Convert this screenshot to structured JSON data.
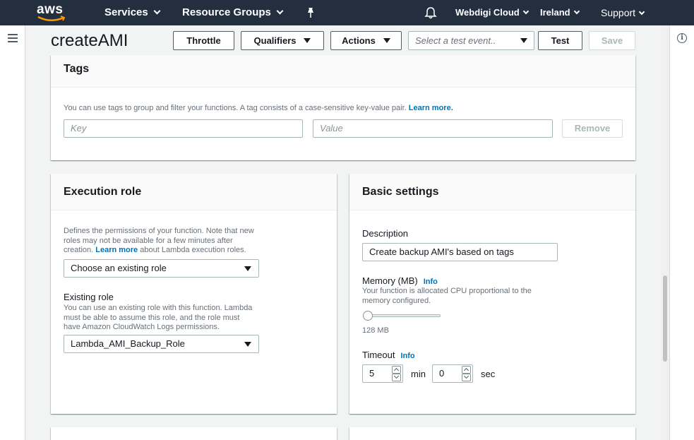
{
  "topnav": {
    "logo_text": "aws",
    "services": "Services",
    "resource_groups": "Resource Groups",
    "account": "Webdigi Cloud",
    "region": "Ireland",
    "support": "Support"
  },
  "header": {
    "function_name": "createAMI",
    "throttle_label": "Throttle",
    "qualifiers_label": "Qualifiers",
    "actions_label": "Actions",
    "test_event_placeholder": "Select a test event..",
    "test_label": "Test",
    "save_label": "Save"
  },
  "tags": {
    "title": "Tags",
    "description": "You can use tags to group and filter your functions. A tag consists of a case-sensitive key-value pair.",
    "learn_more": "Learn more.",
    "key_placeholder": "Key",
    "value_placeholder": "Value",
    "remove_label": "Remove"
  },
  "execution_role": {
    "title": "Execution role",
    "description_line1": "Defines the permissions of your function. Note that new",
    "description_line2": "roles may not be available for a few minutes after",
    "description_line3_pre": "creation.",
    "learn_more": "Learn more",
    "description_line3_post": "about Lambda execution roles.",
    "role_choice": "Choose an existing role",
    "existing_role_label": "Existing role",
    "existing_role_help_line1": "You can use an existing role with this function. Lambda",
    "existing_role_help_line2": "must be able to assume this role, and the role must",
    "existing_role_help_line3": "have Amazon CloudWatch Logs permissions.",
    "existing_role_value": "Lambda_AMI_Backup_Role"
  },
  "basic_settings": {
    "title": "Basic settings",
    "description_label": "Description",
    "description_value": "Create backup AMI's based on tags",
    "memory_label": "Memory (MB)",
    "memory_info": "Info",
    "memory_help_line1": "Your function is allocated CPU proportional to the",
    "memory_help_line2": "memory configured.",
    "memory_value": "128 MB",
    "memory_slider_fraction": 0,
    "timeout_label": "Timeout",
    "timeout_info": "Info",
    "timeout_min": "5",
    "timeout_min_unit": "min",
    "timeout_sec": "0",
    "timeout_sec_unit": "sec"
  },
  "colors": {
    "nav_bg": "#232f3e",
    "link": "#0073bb",
    "page_bg": "#f2f3f3"
  }
}
